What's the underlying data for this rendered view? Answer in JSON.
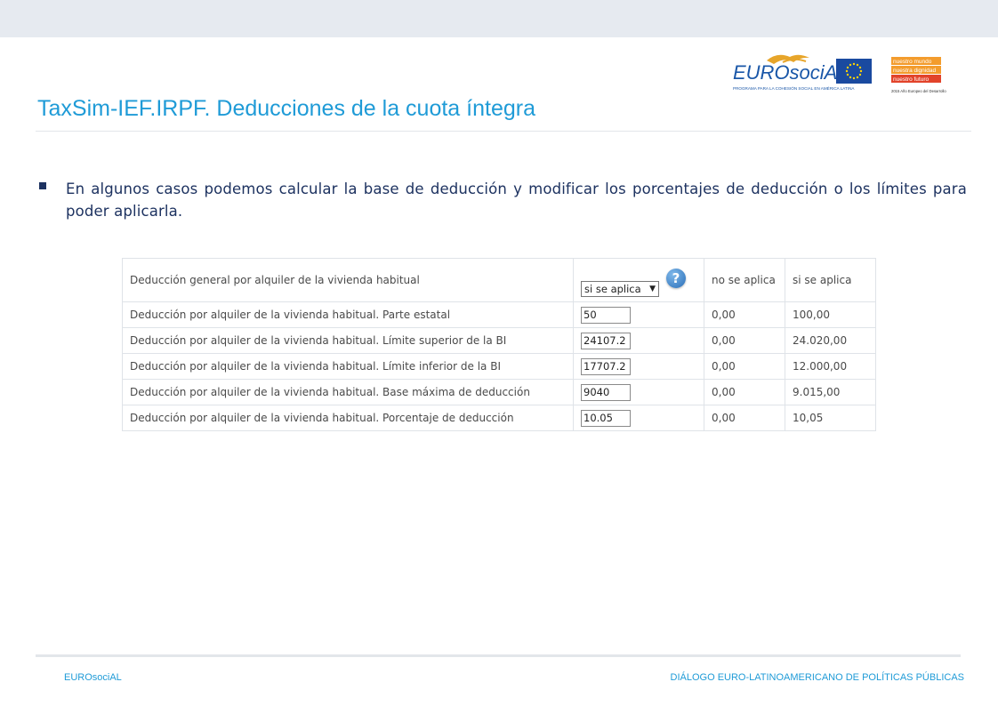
{
  "slide": {
    "title": "TaxSim-IEF.IRPF. Deducciones de la cuota íntegra",
    "bullet": "En algunos casos podemos calcular la base de deducción y modificar los porcentajes de deducción o los límites para poder aplicarla."
  },
  "logos": {
    "eurosocial_text": "EUROsociAL",
    "eurosocial_tagline": "PROGRAMA PARA LA COHESIÓN SOCIAL EN AMÉRICA LATINA",
    "nm_line1": "nuestro mundo",
    "nm_line2": "nuestra dignidad",
    "nm_line3": "nuestro futuro",
    "nm_caption": "2015 Año Europeo del Desarrollo",
    "colors": {
      "eurosocial_blue": "#1a57a8",
      "eurosocial_gold": "#e7a52a",
      "eu_blue": "#1a4aa0",
      "eu_star": "#ffd200",
      "nm_orange": "#f39c2d",
      "nm_red": "#e2432a"
    }
  },
  "table": {
    "header": {
      "label": "Deducción general por alquiler de la vivienda habitual",
      "select_value": "si se aplica",
      "select_arrow": "▼",
      "help_icon": "?",
      "col_no": "no se aplica",
      "col_si": "si se aplica"
    },
    "rows": [
      {
        "label": "Deducción por alquiler de la vivienda habitual. Parte estatal",
        "input": "50",
        "no": "0,00",
        "si": "100,00"
      },
      {
        "label": "Deducción por alquiler de la vivienda habitual. Límite superior de la BI",
        "input": "24107.2",
        "no": "0,00",
        "si": "24.020,00"
      },
      {
        "label": "Deducción por alquiler de la vivienda habitual. Límite inferior de la BI",
        "input": "17707.2",
        "no": "0,00",
        "si": "12.000,00"
      },
      {
        "label": "Deducción por alquiler de la vivienda habitual. Base máxima de deducción",
        "input": "9040",
        "no": "0,00",
        "si": "9.015,00"
      },
      {
        "label": "Deducción por alquiler de la vivienda habitual. Porcentaje de deducción",
        "input": "10.05",
        "no": "0,00",
        "si": "10,05"
      }
    ]
  },
  "footer": {
    "left": "EUROsociAL",
    "right": "DIÁLOGO EURO-LATINOAMERICANO DE POLÍTICAS PÚBLICAS"
  }
}
